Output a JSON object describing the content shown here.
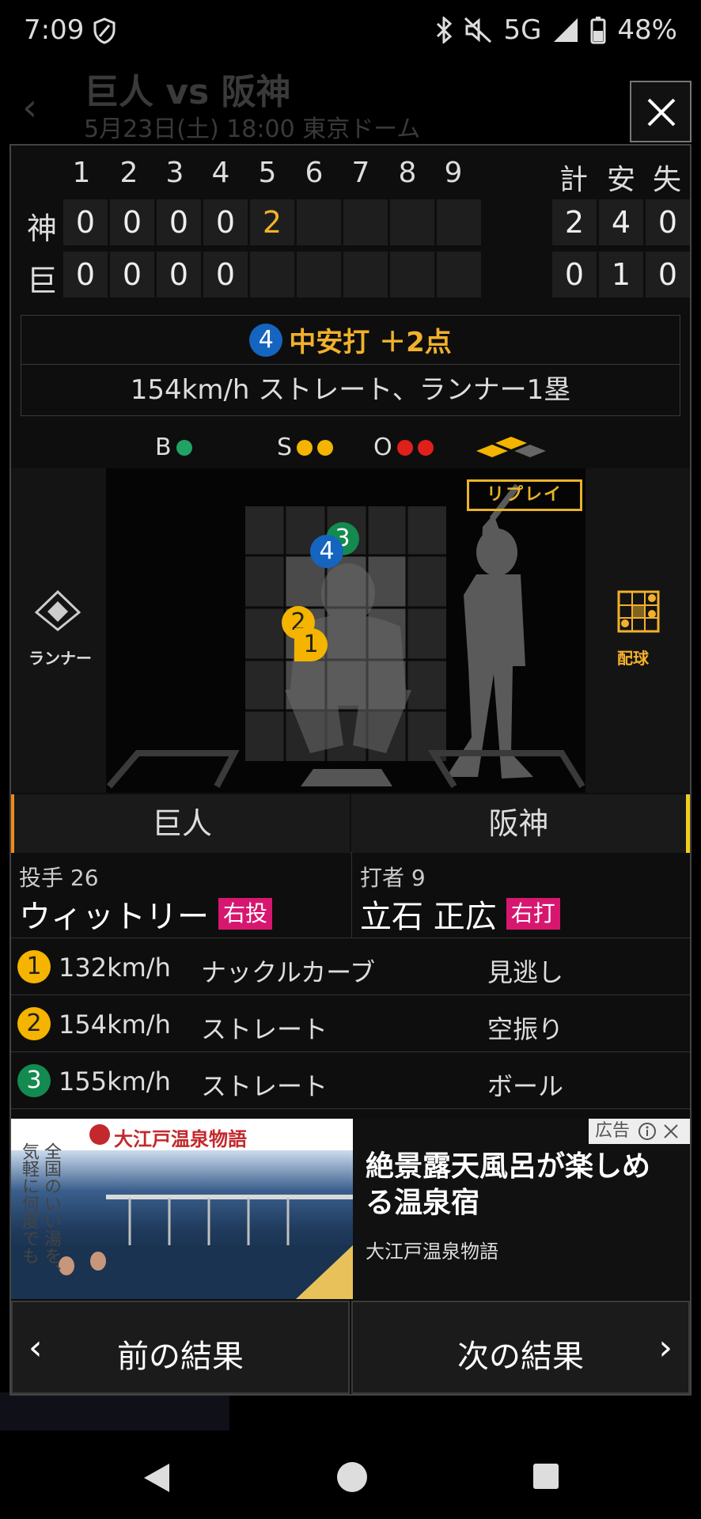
{
  "status": {
    "time": "7:09",
    "network": "5G",
    "battery": "48%"
  },
  "background": {
    "title": "巨人 vs 阪神",
    "subtitle": "5月23日(土) 18:00 東京ドーム"
  },
  "scoreboard": {
    "innings": [
      "1",
      "2",
      "3",
      "4",
      "5",
      "6",
      "7",
      "8",
      "9"
    ],
    "totals_headers": [
      "計",
      "安",
      "失"
    ],
    "rows": [
      {
        "team": "神",
        "innings": [
          "0",
          "0",
          "0",
          "0",
          "2",
          "",
          "",
          "",
          ""
        ],
        "totals": [
          "2",
          "4",
          "0"
        ]
      },
      {
        "team": "巨",
        "innings": [
          "0",
          "0",
          "0",
          "0",
          "",
          "",
          "",
          "",
          ""
        ],
        "totals": [
          "0",
          "1",
          "0"
        ]
      }
    ]
  },
  "play": {
    "pitch_no": "4",
    "result": "中安打 ＋2点",
    "detail": "154km/h ストレート、ランナー1塁"
  },
  "count": {
    "b_label": "B",
    "s_label": "S",
    "o_label": "O",
    "balls": 1,
    "strikes": 2,
    "outs": 2
  },
  "field": {
    "replay_label": "リプレイ",
    "runner_label": "ランナー",
    "pitch_chart_label": "配球"
  },
  "teams": {
    "left": "巨人",
    "right": "阪神"
  },
  "pitcher": {
    "role": "投手 26",
    "name": "ウィットリー",
    "hand": "右投"
  },
  "batter": {
    "role": "打者 9",
    "name": "立石 正広",
    "hand": "右打"
  },
  "pitches": [
    {
      "no": "1",
      "speed": "132km/h",
      "type": "ナックルカーブ",
      "result": "見逃し",
      "color": "yellow"
    },
    {
      "no": "2",
      "speed": "154km/h",
      "type": "ストレート",
      "result": "空振り",
      "color": "yellow"
    },
    {
      "no": "3",
      "speed": "155km/h",
      "type": "ストレート",
      "result": "ボール",
      "color": "green"
    }
  ],
  "ad": {
    "brand": "大江戸温泉物語",
    "image_text_1": "全国のいい湯を、",
    "image_text_2": "気軽に何度でも",
    "headline": "絶景露天風呂が楽しめる温泉宿",
    "advertiser": "大江戸温泉物語",
    "label": "広告"
  },
  "nav": {
    "prev": "前の結果",
    "next": "次の結果"
  }
}
